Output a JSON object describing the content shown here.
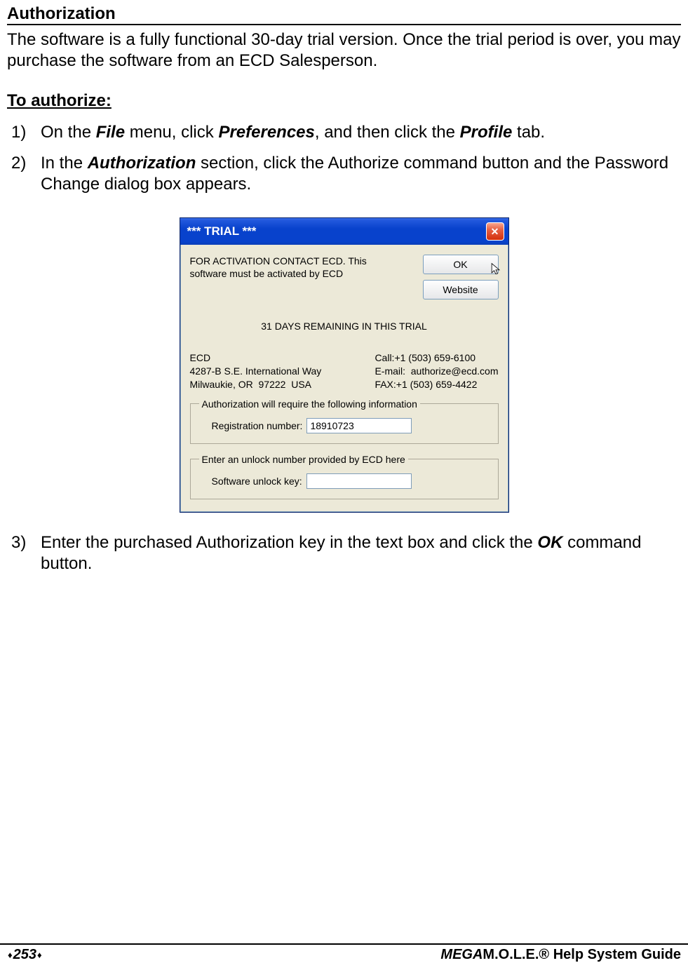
{
  "page": {
    "section_title": "Authorization",
    "intro": "The software is a fully functional 30-day trial version. Once the trial period is over, you may purchase the software from an ECD Salesperson.",
    "subheader": "To authorize:",
    "step1_pre": "On the ",
    "step1_file": "File",
    "step1_mid1": " menu, click ",
    "step1_prefs": "Preferences",
    "step1_mid2": ", and then click the ",
    "step1_profile": "Profile",
    "step1_end": " tab.",
    "step2_pre": "In the ",
    "step2_auth": "Authorization",
    "step2_end": " section, click the Authorize command button and the Password Change dialog box appears.",
    "step3_pre": "Enter the purchased Authorization key in the text box and click the ",
    "step3_ok": "OK",
    "step3_end": " command button."
  },
  "dialog": {
    "title": "*** TRIAL ***",
    "message": "FOR ACTIVATION CONTACT ECD. This software must be activated by ECD",
    "ok_label": "OK",
    "website_label": "Website",
    "remaining": "31 DAYS REMAINING IN THIS TRIAL",
    "address_line1": "ECD",
    "address_line2": "4287-B S.E. International Way",
    "address_line3": "Milwaukie, OR  97222  USA",
    "contact_call": "Call:+1 (503) 659-6100",
    "contact_email": "E-mail:  authorize@ecd.com",
    "contact_fax": "FAX:+1 (503) 659-4422",
    "group1_legend": "Authorization will require the following information",
    "reg_label": "Registration number:",
    "reg_value": "18910723",
    "group2_legend": "Enter an unlock number provided by ECD here",
    "unlock_label": "Software unlock key:",
    "unlock_value": ""
  },
  "footer": {
    "page_number": "253",
    "guide_mega": "MEGA",
    "guide_rest": "M.O.L.E.® Help System Guide"
  }
}
